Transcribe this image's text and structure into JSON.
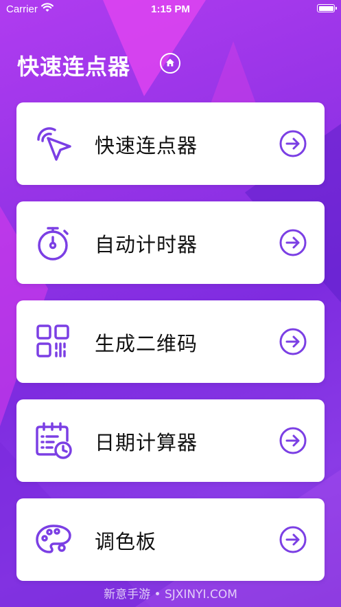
{
  "status_bar": {
    "carrier": "Carrier",
    "time": "1:15 PM"
  },
  "app": {
    "title": "快速连点器",
    "accent_color": "#7b3fe4",
    "home_icon": "home-icon"
  },
  "menu": [
    {
      "label": "快速连点器",
      "icon": "cursor-click-icon"
    },
    {
      "label": "自动计时器",
      "icon": "stopwatch-icon"
    },
    {
      "label": "生成二维码",
      "icon": "qr-code-icon"
    },
    {
      "label": "日期计算器",
      "icon": "calendar-clock-icon"
    },
    {
      "label": "调色板",
      "icon": "palette-icon"
    }
  ],
  "footer": {
    "watermark": "新意手游 • SJXINYI.COM"
  }
}
